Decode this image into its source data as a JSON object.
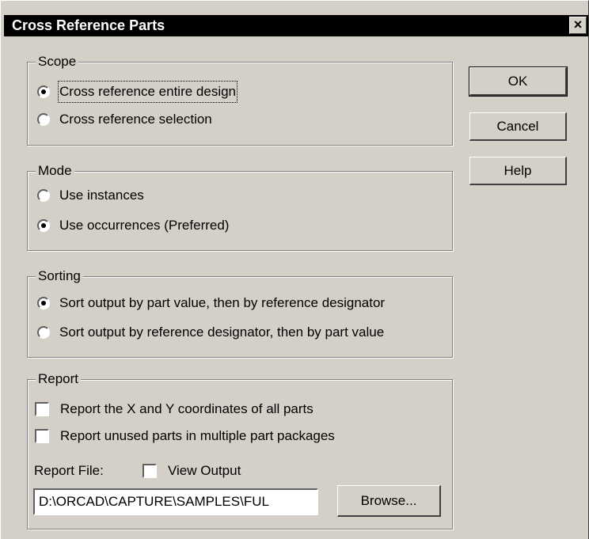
{
  "dialog": {
    "title": "Cross Reference Parts",
    "close_glyph": "×"
  },
  "scope": {
    "legend": "Scope",
    "options": [
      {
        "label": "Cross reference entire design",
        "selected": true
      },
      {
        "label": "Cross reference selection",
        "selected": false
      }
    ]
  },
  "mode": {
    "legend": "Mode",
    "options": [
      {
        "label": "Use instances",
        "selected": false
      },
      {
        "label": "Use occurrences (Preferred)",
        "selected": true
      }
    ]
  },
  "sorting": {
    "legend": "Sorting",
    "options": [
      {
        "label": "Sort output by part value, then by reference designator",
        "selected": true
      },
      {
        "label": "Sort output by reference designator, then by part value",
        "selected": false
      }
    ]
  },
  "report": {
    "legend": "Report",
    "checkboxes": [
      {
        "label": "Report the X and Y coordinates of all parts",
        "checked": false
      },
      {
        "label": "Report unused parts in multiple part packages",
        "checked": false
      }
    ],
    "file_label": "Report File:",
    "view_output_label": "View Output",
    "view_output_checked": false,
    "file_value": "D:\\ORCAD\\CAPTURE\\SAMPLES\\FUL",
    "browse_label": "Browse..."
  },
  "buttons": {
    "ok": "OK",
    "cancel": "Cancel",
    "help": "Help"
  }
}
